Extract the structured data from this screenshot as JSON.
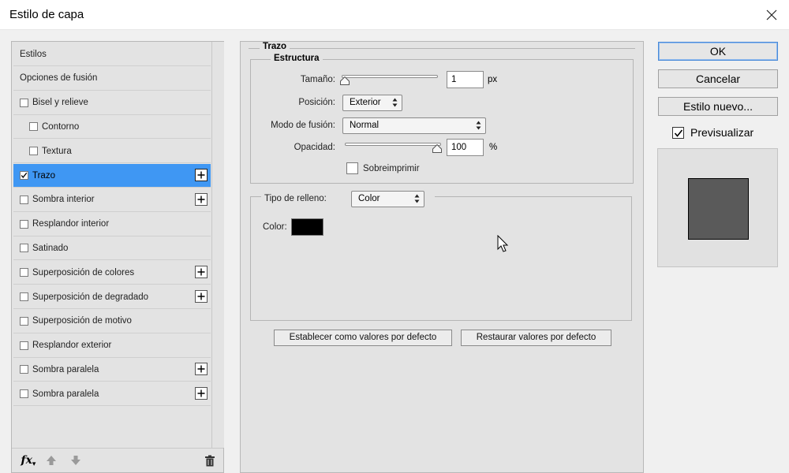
{
  "window": {
    "title": "Estilo de capa"
  },
  "left_panel": {
    "items": [
      {
        "label": "Estilos",
        "checkbox": false,
        "checked": false,
        "indent": false,
        "plus": false,
        "selected": false
      },
      {
        "label": "Opciones de fusión",
        "checkbox": false,
        "checked": false,
        "indent": false,
        "plus": false,
        "selected": false
      },
      {
        "label": "Bisel y relieve",
        "checkbox": true,
        "checked": false,
        "indent": false,
        "plus": false,
        "selected": false
      },
      {
        "label": "Contorno",
        "checkbox": true,
        "checked": false,
        "indent": true,
        "plus": false,
        "selected": false
      },
      {
        "label": "Textura",
        "checkbox": true,
        "checked": false,
        "indent": true,
        "plus": false,
        "selected": false
      },
      {
        "label": "Trazo",
        "checkbox": true,
        "checked": true,
        "indent": false,
        "plus": true,
        "selected": true
      },
      {
        "label": "Sombra interior",
        "checkbox": true,
        "checked": false,
        "indent": false,
        "plus": true,
        "selected": false
      },
      {
        "label": "Resplandor interior",
        "checkbox": true,
        "checked": false,
        "indent": false,
        "plus": false,
        "selected": false
      },
      {
        "label": "Satinado",
        "checkbox": true,
        "checked": false,
        "indent": false,
        "plus": false,
        "selected": false
      },
      {
        "label": "Superposición de colores",
        "checkbox": true,
        "checked": false,
        "indent": false,
        "plus": true,
        "selected": false
      },
      {
        "label": "Superposición de degradado",
        "checkbox": true,
        "checked": false,
        "indent": false,
        "plus": true,
        "selected": false
      },
      {
        "label": "Superposición de motivo",
        "checkbox": true,
        "checked": false,
        "indent": false,
        "plus": false,
        "selected": false
      },
      {
        "label": "Resplandor exterior",
        "checkbox": true,
        "checked": false,
        "indent": false,
        "plus": false,
        "selected": false
      },
      {
        "label": "Sombra paralela",
        "checkbox": true,
        "checked": false,
        "indent": false,
        "plus": true,
        "selected": false
      },
      {
        "label": "Sombra paralela",
        "checkbox": true,
        "checked": false,
        "indent": false,
        "plus": true,
        "selected": false
      }
    ],
    "footer": {
      "fx_label": "fx",
      "icons": [
        "fx-icon",
        "move-up-icon",
        "move-down-icon",
        "trash-icon"
      ]
    }
  },
  "stroke": {
    "section_title": "Trazo",
    "structure_title": "Estructura",
    "size": {
      "label": "Tamaño:",
      "value": "1",
      "unit": "px",
      "slider_fraction": 0.0
    },
    "position": {
      "label": "Posición:",
      "value": "Exterior"
    },
    "blend_mode": {
      "label": "Modo de fusión:",
      "value": "Normal"
    },
    "opacity": {
      "label": "Opacidad:",
      "value": "100",
      "unit": "%",
      "slider_fraction": 1.0
    },
    "overprint": {
      "label": "Sobreimprimir",
      "checked": false
    },
    "fill_type": {
      "label": "Tipo de relleno:",
      "value": "Color"
    },
    "color": {
      "label": "Color:",
      "value": "#000000"
    },
    "buttons": {
      "set_default": "Establecer como valores por defecto",
      "reset_default": "Restaurar valores por defecto"
    }
  },
  "actions": {
    "ok": "OK",
    "cancel": "Cancelar",
    "new_style": "Estilo nuevo...",
    "preview_label": "Previsualizar",
    "preview_checked": true
  },
  "colors": {
    "selection": "#3f97f3",
    "panel": "#e3e3e3",
    "preview_fill": "#5a5a5a"
  }
}
